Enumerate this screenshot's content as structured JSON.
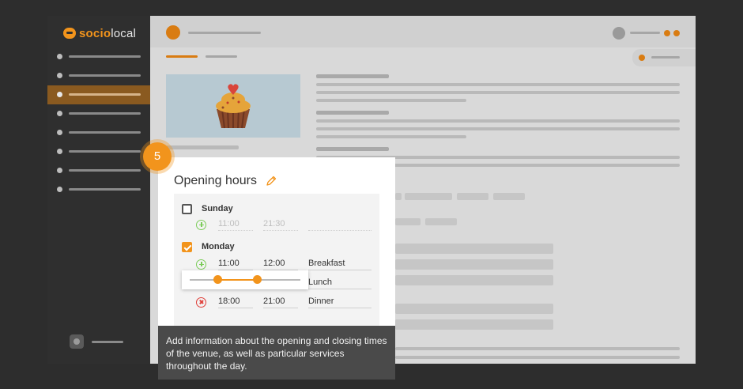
{
  "app": {
    "logo_prefix": "socio",
    "logo_suffix": "local"
  },
  "card": {
    "title": "Opening hours",
    "days": [
      {
        "name": "Sunday",
        "checked": false,
        "slots": [
          {
            "action": "add",
            "start": "11:00",
            "end": "21:30",
            "label": "",
            "muted": true
          }
        ]
      },
      {
        "name": "Monday",
        "checked": true,
        "slots": [
          {
            "action": "add",
            "start": "11:00",
            "end": "12:00",
            "label": "Breakfast",
            "muted": false
          },
          {
            "action": "remove",
            "start": "",
            "end": "",
            "label": "Lunch",
            "muted": false
          },
          {
            "action": "remove",
            "start": "18:00",
            "end": "21:00",
            "label": "Dinner",
            "muted": false
          }
        ]
      }
    ]
  },
  "step": {
    "number": "5",
    "description": "Add information about the opening and closing times of the venue, as well as particular services throughout the day."
  },
  "colors": {
    "accent": "#f2941c",
    "add": "#7ccc5a",
    "remove": "#e0403a"
  }
}
